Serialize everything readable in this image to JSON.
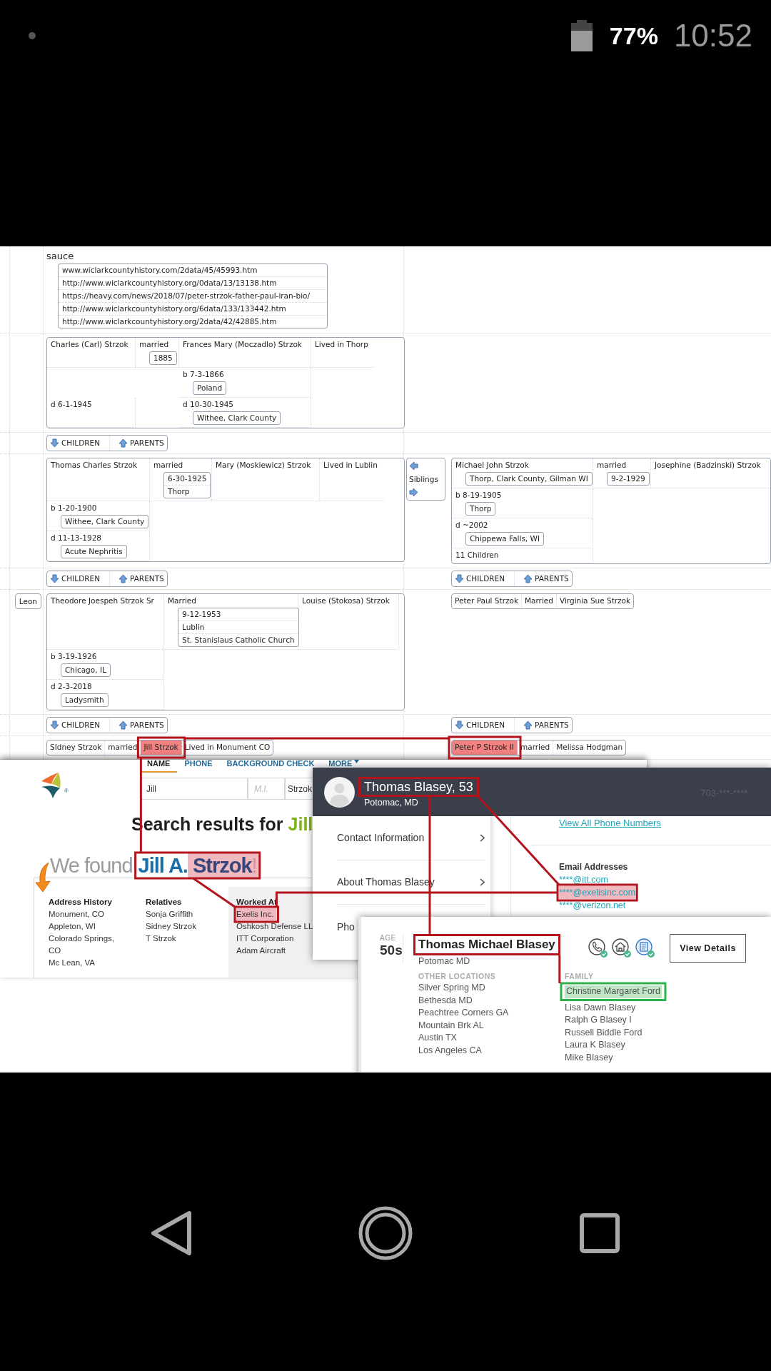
{
  "status_bar": {
    "battery": "77%",
    "time": "10:52"
  },
  "genealogy": {
    "sources": {
      "label": "sauce",
      "links": [
        "www.wiclarkcountyhistory.com/2data/45/45993.htm",
        "http://www.wiclarkcountyhistory.org/0data/13/13138.htm",
        "https://heavy.com/news/2018/07/peter-strzok-father-paul-iran-bio/",
        "http://www.wiclarkcountyhistory.org/6data/133/133442.htm",
        "http://www.wiclarkcountyhistory.org/2data/42/42885.htm"
      ]
    },
    "rows": [
      {
        "left": {
          "kind": "family",
          "spouse1": "Charles (Carl) Strzok",
          "relation": "married",
          "marriage": [
            "1885"
          ],
          "spouse2": "Frances Mary (Moczadlo) Strzok",
          "note": "Lived in Thorp",
          "events": [
            {
              "right": {
                "text": "b 7-3-1866",
                "place": "Poland"
              }
            },
            {
              "left": {
                "text": "d 6-1-1945"
              },
              "right": {
                "text": "d 10-30-1945",
                "place": "Withee, Clark County"
              }
            }
          ]
        }
      },
      {
        "left": {
          "kind": "nav",
          "children": "CHILDREN",
          "parents": "PARENTS"
        }
      },
      {
        "left": {
          "kind": "family",
          "spouse1": "Thomas Charles Strzok",
          "relation": "married",
          "marriage": [
            "6-30-1925",
            "Thorp"
          ],
          "spouse2": "Mary (Moskiewicz) Strzok",
          "note": "Lived in Lublin",
          "events": [
            {
              "left": {
                "text": "b 1-20-1900",
                "place": "Withee, Clark County"
              }
            },
            {
              "left": {
                "text": "d 11-13-1928",
                "place": "Acute Nephritis"
              }
            }
          ]
        },
        "siblings": "Siblings",
        "right": {
          "kind": "family",
          "spouse1": "Michael John Strzok",
          "spouse1_place": "Thorp, Clark County, Gilman WI",
          "relation": "married",
          "marriage": [
            "9-2-1929"
          ],
          "spouse2": "Josephine (Badzinski) Strzok",
          "events": [
            {
              "left": {
                "text": "b 8-19-1905",
                "place": "Thorp"
              }
            },
            {
              "left": {
                "text": "d ~2002",
                "place": "Chippewa Falls, WI"
              }
            },
            {
              "left": {
                "text": "11 Children"
              }
            }
          ]
        }
      },
      {
        "left": {
          "kind": "nav",
          "children": "CHILDREN",
          "parents": "PARENTS"
        },
        "right": {
          "kind": "nav",
          "children": "CHILDREN",
          "parents": "PARENTS"
        }
      },
      {
        "gutter": "Leon",
        "left": {
          "kind": "family",
          "spouse1": "Theodore Joespeh Strzok Sr",
          "relation": "Married",
          "marriage": [
            "9-12-1953",
            "Lublin",
            "St. Stanislaus Catholic Church"
          ],
          "spouse2": "Louise (Stokosa) Strzok",
          "events": [
            {
              "left": {
                "text": "b 3-19-1926",
                "place": "Chicago, IL"
              }
            },
            {
              "left": {
                "text": "d 2-3-2018",
                "place": "Ladysmith"
              }
            }
          ]
        },
        "right": {
          "kind": "couple",
          "cells": [
            {
              "text": "Peter Paul Strzok",
              "highlighted": false
            },
            {
              "text": "Married",
              "highlighted": false
            },
            {
              "text": "Virginia Sue Strzok",
              "highlighted": false
            }
          ]
        }
      },
      {
        "left": {
          "kind": "nav",
          "children": "CHILDREN",
          "parents": "PARENTS"
        },
        "right": {
          "kind": "nav",
          "children": "CHILDREN",
          "parents": "PARENTS"
        }
      },
      {
        "left": {
          "kind": "couple",
          "cells": [
            {
              "text": "SIdney Strzok",
              "highlighted": false
            },
            {
              "text": "married",
              "highlighted": false
            },
            {
              "text": "Jill Strzok",
              "highlighted": true
            },
            {
              "text": "Lived in Monument CO",
              "highlighted": false
            }
          ]
        },
        "right": {
          "kind": "couple",
          "cells": [
            {
              "text": "Peter P Strzok II",
              "highlighted": true
            },
            {
              "text": "married",
              "highlighted": false
            },
            {
              "text": "Melissa Hodgman",
              "highlighted": false
            }
          ]
        }
      }
    ]
  },
  "people_search": {
    "logo_mark": "®",
    "tabs": [
      {
        "label": "NAME",
        "selected": true
      },
      {
        "label": "PHONE",
        "selected": false
      },
      {
        "label": "BACKGROUND CHECK",
        "selected": false
      },
      {
        "label": "MORE",
        "selected": false
      }
    ],
    "fields": [
      {
        "value": "Jill"
      },
      {
        "placeholder": "M.I."
      },
      {
        "value": "Strzok"
      }
    ],
    "heading": "Search results for",
    "heading_name": "Jill",
    "found": {
      "prefix": "We found",
      "first": "Jill A.",
      "last": "Strzok",
      "suffix": "!",
      "last_highlighted": true
    },
    "columns": [
      {
        "title": "Address History",
        "items": [
          {
            "text": "Monument, CO",
            "highlighted": false
          },
          {
            "text": "Appleton, WI",
            "highlighted": false
          },
          {
            "text": "Colorado Springs, CO",
            "highlighted": false
          },
          {
            "text": "Mc Lean, VA",
            "highlighted": false
          }
        ]
      },
      {
        "title": "Relatives",
        "items": [
          {
            "text": "Sonja Griffith",
            "highlighted": false
          },
          {
            "text": "Sidney Strzok",
            "highlighted": false
          },
          {
            "text": "T Strzok",
            "highlighted": false
          }
        ]
      },
      {
        "title": "Worked At",
        "items": [
          {
            "text": "Exelis Inc.",
            "highlighted": true
          },
          {
            "text": "Oshkosh Defense LL",
            "highlighted": false
          },
          {
            "text": "ITT Corporation",
            "highlighted": false
          },
          {
            "text": "Adam Aircraft",
            "highlighted": false
          }
        ]
      }
    ]
  },
  "profile": {
    "name": "Thomas Blasey, 53",
    "location": "Potomac, MD",
    "phone": "703-***-****",
    "menu": [
      "Contact Information",
      "About Thomas Blasey",
      "Pho"
    ],
    "phones_link": "View All Phone Numbers",
    "emails_title": "Email Addresses",
    "emails": [
      {
        "text": "****@itt.com",
        "highlighted": false
      },
      {
        "text": "****@exelisinc.com",
        "highlighted": true
      },
      {
        "text": "****@verizon.net",
        "highlighted": false
      }
    ]
  },
  "record": {
    "age_label": "AGE",
    "age": "50s",
    "name": "Thomas Michael Blasey",
    "location": "Potomac MD",
    "button": "View Details",
    "locations_title": "OTHER LOCATIONS",
    "locations": [
      "Silver Spring MD",
      "Bethesda MD",
      "Peachtree Corners GA",
      "Mountain Brk AL",
      "Austin TX",
      "Los Angeles CA"
    ],
    "family_title": "FAMILY",
    "family": [
      {
        "text": "Christine Margaret Ford",
        "highlighted": true
      },
      {
        "text": "Lisa Dawn Blasey",
        "highlighted": false
      },
      {
        "text": "Ralph G Blasey I",
        "highlighted": false
      },
      {
        "text": "Russell Biddle Ford",
        "highlighted": false
      },
      {
        "text": "Laura K Blasey",
        "highlighted": false
      },
      {
        "text": "Mike Blasey",
        "highlighted": false
      }
    ]
  }
}
